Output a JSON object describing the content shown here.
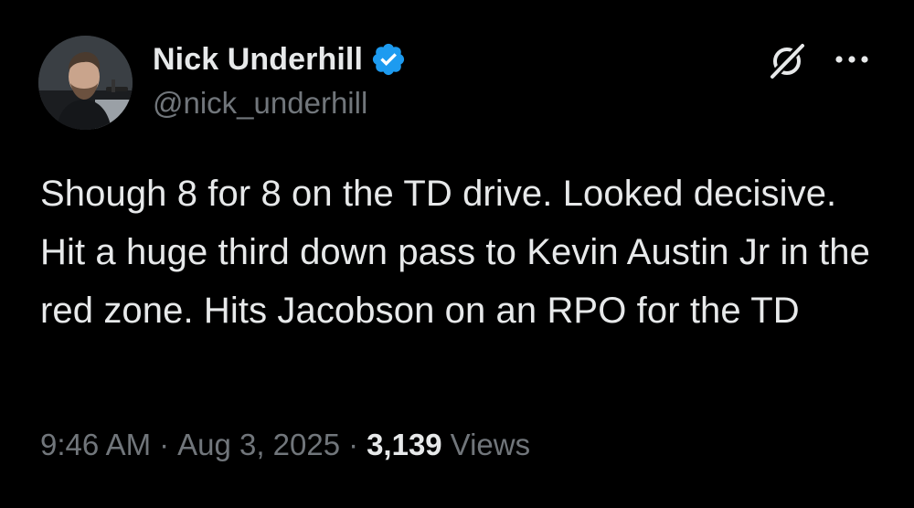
{
  "author": {
    "display_name": "Nick Underhill",
    "handle": "@nick_underhill",
    "verified": true
  },
  "tweet": {
    "text": "Shough 8 for 8 on the TD drive. Looked decisive. Hit a huge third down pass to Kevin Austin Jr in the red zone. Hits Jacobson on an RPO for the TD",
    "time": "9:46 AM",
    "separator": "·",
    "date": "Aug 3, 2025",
    "views_count": "3,139",
    "views_label": "Views"
  },
  "icons": {
    "verified": "verified-badge-icon",
    "grok": "grok-icon",
    "more": "more-options-icon"
  },
  "colors": {
    "background": "#000000",
    "primary_text": "#e7e9ea",
    "secondary_text": "#71767b",
    "verified_blue": "#1d9bf0"
  }
}
